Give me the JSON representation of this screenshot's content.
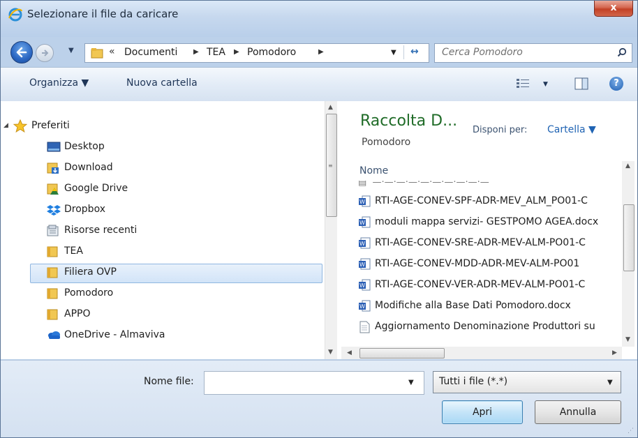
{
  "window": {
    "title": "Selezionare il file da caricare",
    "close_label": "x"
  },
  "address": {
    "overflow": "«",
    "crumbs": [
      "Documenti",
      "TEA",
      "Pomodoro"
    ],
    "search_placeholder": "Cerca Pomodoro"
  },
  "toolbar": {
    "organize": "Organizza ▼",
    "new_folder": "Nuova cartella",
    "help": "?"
  },
  "nav": {
    "favorites": "Preferiti",
    "items": [
      "Desktop",
      "Download",
      "Google Drive",
      "Dropbox",
      "Risorse recenti",
      "TEA",
      "Filiera OVP",
      "Pomodoro",
      "APPO",
      "OneDrive - Almaviva"
    ],
    "selected": "Pomodoro"
  },
  "library": {
    "title": "Raccolta D...",
    "subtitle": "Pomodoro",
    "arrange_label": "Disponi per:",
    "arrange_value": "Cartella ▼",
    "column": "Nome",
    "files": [
      "RTI-AGE-CONEV-SPF-ADR-MEV_ALM_PO01-C",
      "moduli mappa servizi- GESTPOMO AGEA.docx",
      "RTI-AGE-CONEV-SRE-ADR-MEV-ALM-PO01-C",
      "RTI-AGE-CONEV-MDD-ADR-MEV-ALM-PO01",
      "RTI-AGE-CONEV-VER-ADR-MEV-ALM-PO01-C",
      "Modifiche alla Base Dati Pomodoro.docx",
      "Aggiornamento Denominazione Produttori su"
    ]
  },
  "bottom": {
    "file_name_label": "Nome file:",
    "file_name_value": "",
    "filter": "Tutti i file (*.*)",
    "open": "Apri",
    "cancel": "Annulla"
  },
  "colors": {
    "library_title": "#1f6b27",
    "link": "#1f63b3",
    "selection": "#d2e4f8"
  }
}
